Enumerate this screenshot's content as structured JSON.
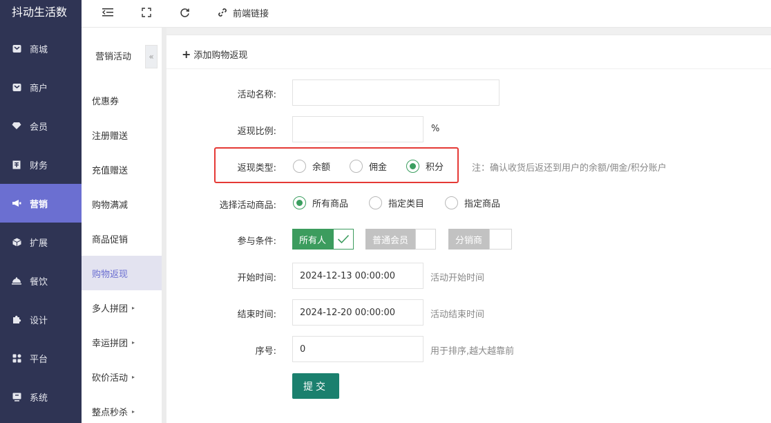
{
  "brand": "抖动生活数",
  "nav": [
    {
      "label": "商城",
      "icon": "store-icon"
    },
    {
      "label": "商户",
      "icon": "merchant-icon"
    },
    {
      "label": "会员",
      "icon": "diamond-icon"
    },
    {
      "label": "财务",
      "icon": "finance-icon"
    },
    {
      "label": "营销",
      "icon": "megaphone-icon",
      "active": true
    },
    {
      "label": "扩展",
      "icon": "cube-icon"
    },
    {
      "label": "餐饮",
      "icon": "food-cover-icon"
    },
    {
      "label": "设计",
      "icon": "puzzle-icon"
    },
    {
      "label": "平台",
      "icon": "grid-icon"
    },
    {
      "label": "系统",
      "icon": "monitor-icon"
    }
  ],
  "topbar": {
    "frontend_link": "前端链接"
  },
  "subnav": {
    "title": "营销活动",
    "collapse": "«",
    "items": [
      {
        "label": "优惠券"
      },
      {
        "label": "注册赠送"
      },
      {
        "label": "充值赠送"
      },
      {
        "label": "购物满减"
      },
      {
        "label": "商品促销"
      },
      {
        "label": "购物返现",
        "active": true
      },
      {
        "label": "多人拼团",
        "more": "▸"
      },
      {
        "label": "幸运拼团",
        "more": "▸"
      },
      {
        "label": "砍价活动",
        "more": "▸"
      },
      {
        "label": "整点秒杀",
        "more": "▸"
      }
    ]
  },
  "form": {
    "header": "添加购物返现",
    "name_label": "活动名称:",
    "name_value": "",
    "ratio_label": "返现比例:",
    "ratio_value": "",
    "ratio_unit": "%",
    "type_label": "返现类型:",
    "type_options": [
      "余额",
      "佣金",
      "积分"
    ],
    "type_selected": 2,
    "type_note": "注：确认收货后返还到用户的余额/佣金/积分账户",
    "goods_label": "选择活动商品:",
    "goods_options": [
      "所有商品",
      "指定类目",
      "指定商品"
    ],
    "goods_selected": 0,
    "cond_label": "参与条件:",
    "cond_options": [
      {
        "label": "所有人",
        "checked": true
      },
      {
        "label": "普通会员",
        "checked": false
      },
      {
        "label": "分销商",
        "checked": false
      }
    ],
    "start_label": "开始时间:",
    "start_value": "2024-12-13 00:00:00",
    "start_hint": "活动开始时间",
    "end_label": "结束时间:",
    "end_value": "2024-12-20 00:00:00",
    "end_hint": "活动结束时间",
    "sort_label": "序号:",
    "sort_value": "0",
    "sort_hint": "用于排序,越大越靠前",
    "submit": "提交"
  },
  "colors": {
    "sidebar_bg": "#2f3454",
    "accent": "#6b6fd1",
    "green": "#3b9e5f",
    "submit": "#1b806e",
    "highlight": "#e53935"
  }
}
